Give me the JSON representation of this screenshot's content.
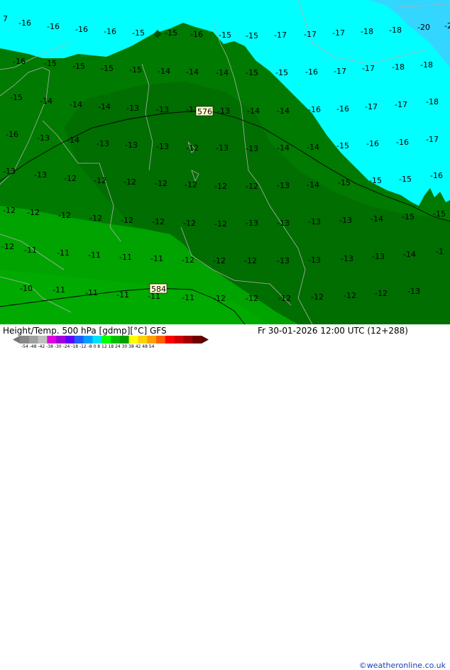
{
  "map": {
    "colors": {
      "band_-24_-18": "#33d6ff",
      "band_-18_-12": "#00ffff",
      "band_-12_-6_dark": "#006f00",
      "band_-12_-6": "#008a00",
      "band_-6_0": "#00b000",
      "coast": "#b0b0b0",
      "contour": "#000000"
    },
    "contour_labels": [
      "576",
      "584"
    ],
    "temperature_labels": [
      "7",
      "-16",
      "-16",
      "-16",
      "-16",
      "-15",
      "-15",
      "-16",
      "-15",
      "-15",
      "-17",
      "-17",
      "-17",
      "-18",
      "-18",
      "-20",
      "-2",
      "-16",
      "-15",
      "-15",
      "-15",
      "-15",
      "-14",
      "-14",
      "-14",
      "-15",
      "-15",
      "-16",
      "-17",
      "-17",
      "-18",
      "-18",
      "-15",
      "-14",
      "-14",
      "-14",
      "-13",
      "-13",
      "-13",
      "-13",
      "-14",
      "-14",
      "-16",
      "-16",
      "-17",
      "-17",
      "-18",
      "-16",
      "-13",
      "-14",
      "-13",
      "-13",
      "-13",
      "-12",
      "-13",
      "-13",
      "-14",
      "-14",
      "-15",
      "-16",
      "-16",
      "-17",
      "-13",
      "-13",
      "-12",
      "-12",
      "-12",
      "-12",
      "-12",
      "-12",
      "-12",
      "-13",
      "-14",
      "-15",
      "-15",
      "-15",
      "-16",
      "-12",
      "-12",
      "-12",
      "-12",
      "-12",
      "-12",
      "-12",
      "-12",
      "-13",
      "-13",
      "-13",
      "-13",
      "-14",
      "-15",
      "-15",
      "-12",
      "-11",
      "-11",
      "-11",
      "-11",
      "-11",
      "-12",
      "-12",
      "-12",
      "-13",
      "-13",
      "-13",
      "-13",
      "-14",
      "-1",
      "-10",
      "-11",
      "-11",
      "-11",
      "-11",
      "-11",
      "-12",
      "-12",
      "-12",
      "-12",
      "-12",
      "-12",
      "-13"
    ]
  },
  "footer": {
    "title": "Height/Temp. 500 hPa [gdmp][°C] GFS",
    "datetime": "Fr 30-01-2026 12:00 UTC (12+288)",
    "credit": "©weatheronline.co.uk",
    "scale_ticks": "-54 -48 -42 -38 -30 -24 -18 -12 -8  0  8  12 18 24 30 38 42 48 54",
    "scale_colors": [
      "#888888",
      "#a0a0a0",
      "#c0c0c0",
      "#e000e0",
      "#a000e0",
      "#6000ff",
      "#1f5fff",
      "#00a0ff",
      "#00e0ff",
      "#00ff00",
      "#00c000",
      "#00a000",
      "#ffff00",
      "#ffd000",
      "#ffa000",
      "#ff6000",
      "#ff0000",
      "#d00000",
      "#a00000",
      "#700000"
    ]
  }
}
